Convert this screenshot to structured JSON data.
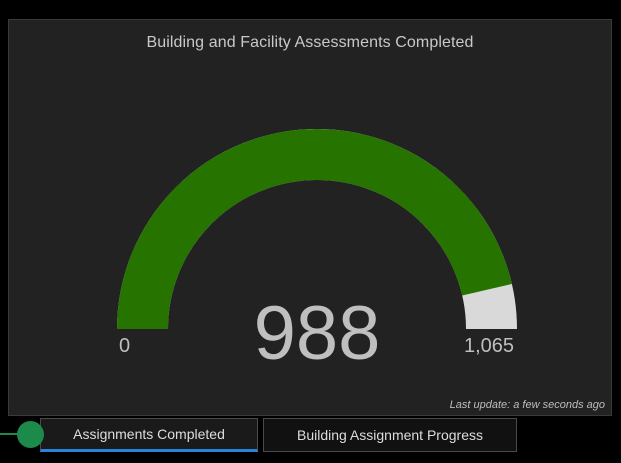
{
  "gauge": {
    "title": "Building and Facility Assessments Completed",
    "value": 988,
    "value_display": "988",
    "min": 0,
    "min_label": "0",
    "max": 1065,
    "max_label": "1,065",
    "fill_color": "#267300",
    "track_color": "#d9d9d9",
    "last_update": "Last update: a few seconds ago"
  },
  "tabs": [
    {
      "label": "Assignments Completed",
      "active": true
    },
    {
      "label": "Building Assignment Progress",
      "active": false
    }
  ],
  "tour_marker": {
    "color": "#1c8a4a"
  }
}
